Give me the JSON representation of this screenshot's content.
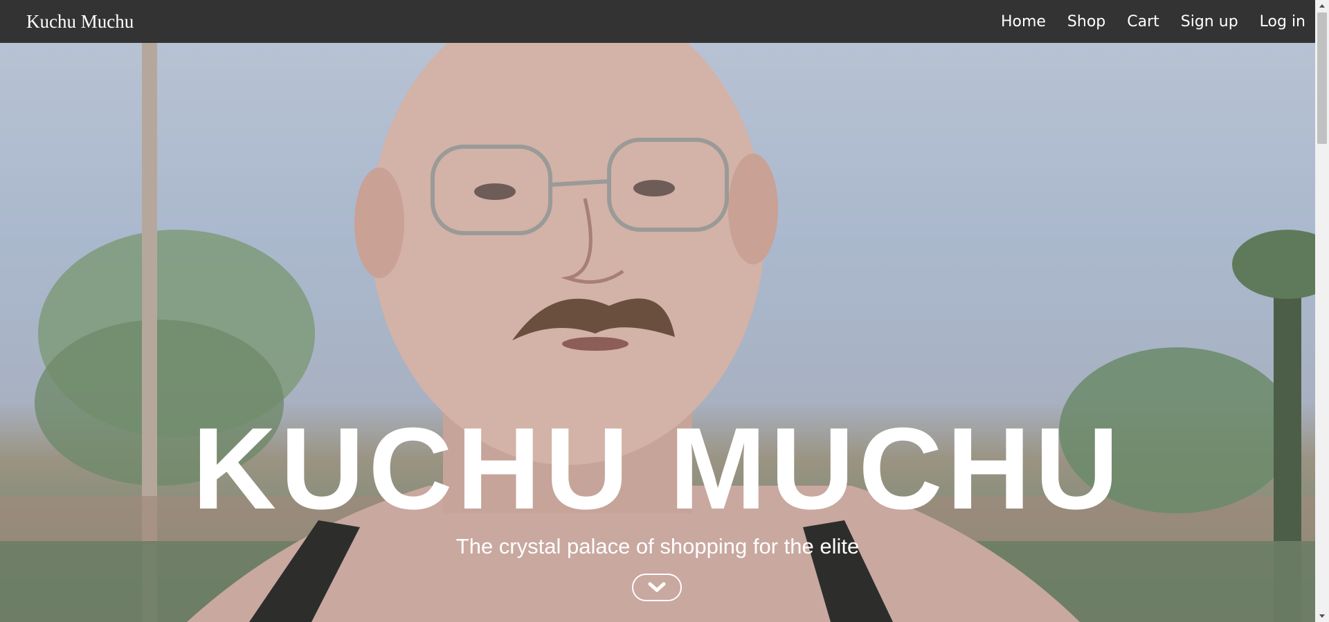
{
  "navbar": {
    "brand": "Kuchu Muchu",
    "links": [
      "Home",
      "Shop",
      "Cart",
      "Sign up",
      "Log in"
    ]
  },
  "hero": {
    "title": "KUCHU MUCHU",
    "subtitle": "The crystal palace of shopping for the elite",
    "scroll_icon": "chevron-down-icon"
  },
  "colors": {
    "navbar_bg": "#333333",
    "text": "#ffffff"
  }
}
